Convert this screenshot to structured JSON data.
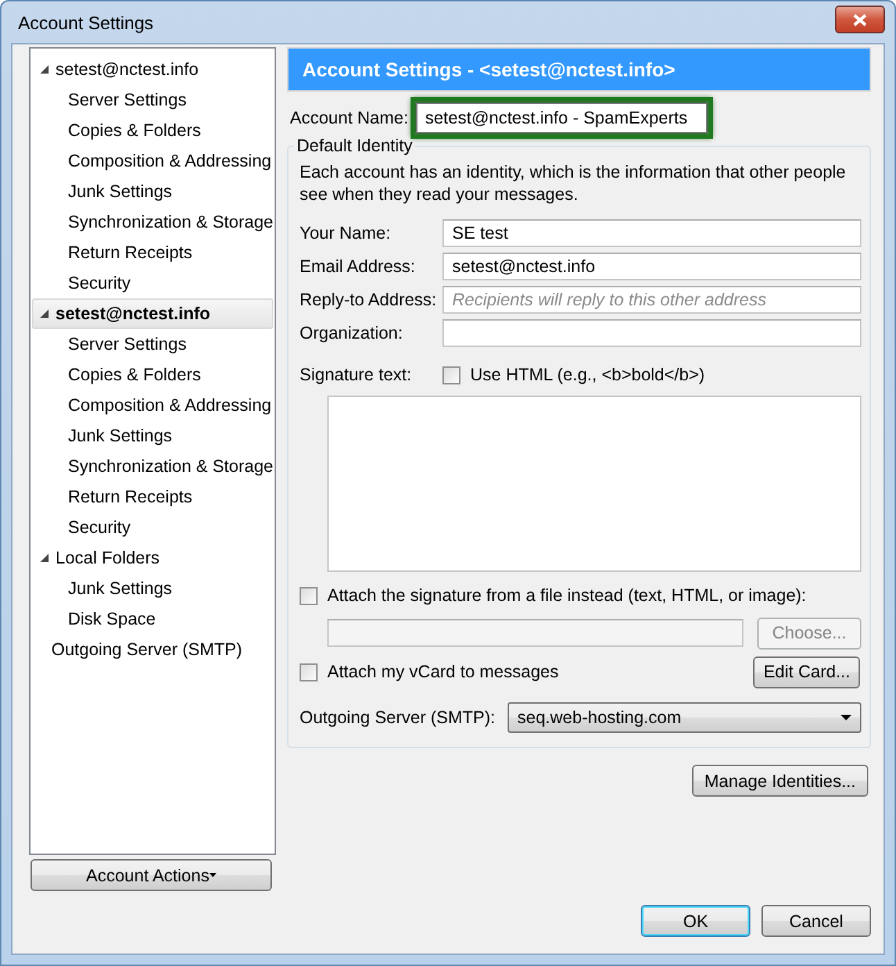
{
  "window": {
    "title": "Account Settings"
  },
  "tree": [
    {
      "label": "setest@nctest.info",
      "expanded": true,
      "selected": false,
      "children": [
        {
          "label": "Server Settings",
          "selected": false
        },
        {
          "label": "Copies & Folders",
          "selected": false
        },
        {
          "label": "Composition & Addressing",
          "selected": false
        },
        {
          "label": "Junk Settings",
          "selected": false
        },
        {
          "label": "Synchronization & Storage",
          "selected": false
        },
        {
          "label": "Return Receipts",
          "selected": false
        },
        {
          "label": "Security",
          "selected": false
        }
      ]
    },
    {
      "label": "setest@nctest.info",
      "expanded": true,
      "selected": true,
      "children": [
        {
          "label": "Server Settings",
          "selected": false
        },
        {
          "label": "Copies & Folders",
          "selected": false
        },
        {
          "label": "Composition & Addressing",
          "selected": false
        },
        {
          "label": "Junk Settings",
          "selected": false
        },
        {
          "label": "Synchronization & Storage",
          "selected": false
        },
        {
          "label": "Return Receipts",
          "selected": false
        },
        {
          "label": "Security",
          "selected": false
        }
      ]
    },
    {
      "label": "Local Folders",
      "expanded": true,
      "selected": false,
      "children": [
        {
          "label": "Junk Settings",
          "selected": false
        },
        {
          "label": "Disk Space",
          "selected": false
        }
      ]
    },
    {
      "label": "Outgoing Server (SMTP)",
      "selected": false
    }
  ],
  "account_actions": {
    "label": "Account Actions"
  },
  "header": {
    "title": "Account Settings - <setest@nctest.info>"
  },
  "account_name": {
    "label": "Account Name:",
    "value": "setest@nctest.info - SpamExperts",
    "focused": true
  },
  "identity": {
    "legend": "Default Identity",
    "description": "Each account has an identity, which is the information that other people see when they read your messages.",
    "fields": [
      {
        "label": "Your Name:",
        "value": "SE test"
      },
      {
        "label": "Email Address:",
        "value": "setest@nctest.info"
      },
      {
        "label": "Reply-to Address:",
        "placeholder": "Recipients will reply to this other address"
      },
      {
        "label": "Organization:"
      }
    ],
    "signature_label": "Signature text:",
    "use_html": {
      "label": "Use HTML (e.g., <b>bold</b>)",
      "checked": false
    },
    "attach_file": {
      "label": "Attach the signature from a file instead (text, HTML, or image):",
      "checked": false
    },
    "choose_button": {
      "label": "Choose...",
      "disabled": true
    },
    "attach_vcard": {
      "label": "Attach my vCard to messages",
      "checked": false
    },
    "edit_card_button": {
      "label": "Edit Card..."
    },
    "outgoing": {
      "label": "Outgoing Server (SMTP):",
      "value": "seq.web-hosting.com"
    }
  },
  "manage_identities": {
    "label": "Manage Identities..."
  },
  "buttons": [
    {
      "label": "OK",
      "default": true
    },
    {
      "label": "Cancel",
      "default": false
    }
  ]
}
